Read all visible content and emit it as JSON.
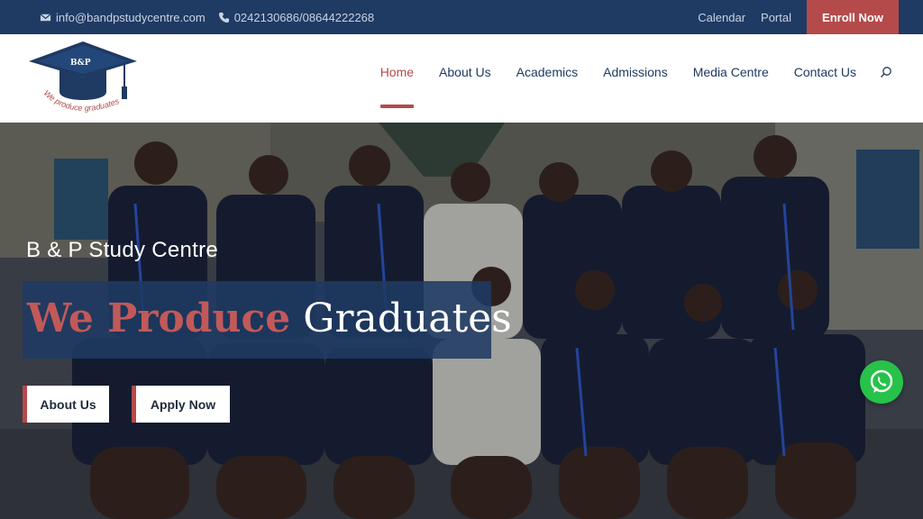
{
  "topbar": {
    "email": "info@bandpstudycentre.com",
    "phone": "0242130686/08644222268",
    "links": [
      "Calendar",
      "Portal"
    ],
    "enroll_label": "Enroll Now",
    "email_icon": "envelope-icon",
    "phone_icon": "phone-icon"
  },
  "logo": {
    "initials": "B&P",
    "tagline": "We produce graduates"
  },
  "nav": {
    "items": [
      "Home",
      "About Us",
      "Academics",
      "Admissions",
      "Media Centre",
      "Contact Us"
    ],
    "active": "Home",
    "search_icon": "search-icon"
  },
  "hero": {
    "subtitle": "B & P Study Centre",
    "headline_accent": "We Produce",
    "headline_rest": "Graduates",
    "buttons": [
      "About Us",
      "Apply Now"
    ]
  },
  "whatsapp": {
    "icon": "whatsapp-icon"
  },
  "colors": {
    "navy": "#1f3a63",
    "accent_red": "#b54a4a",
    "whatsapp_green": "#27c24a"
  }
}
